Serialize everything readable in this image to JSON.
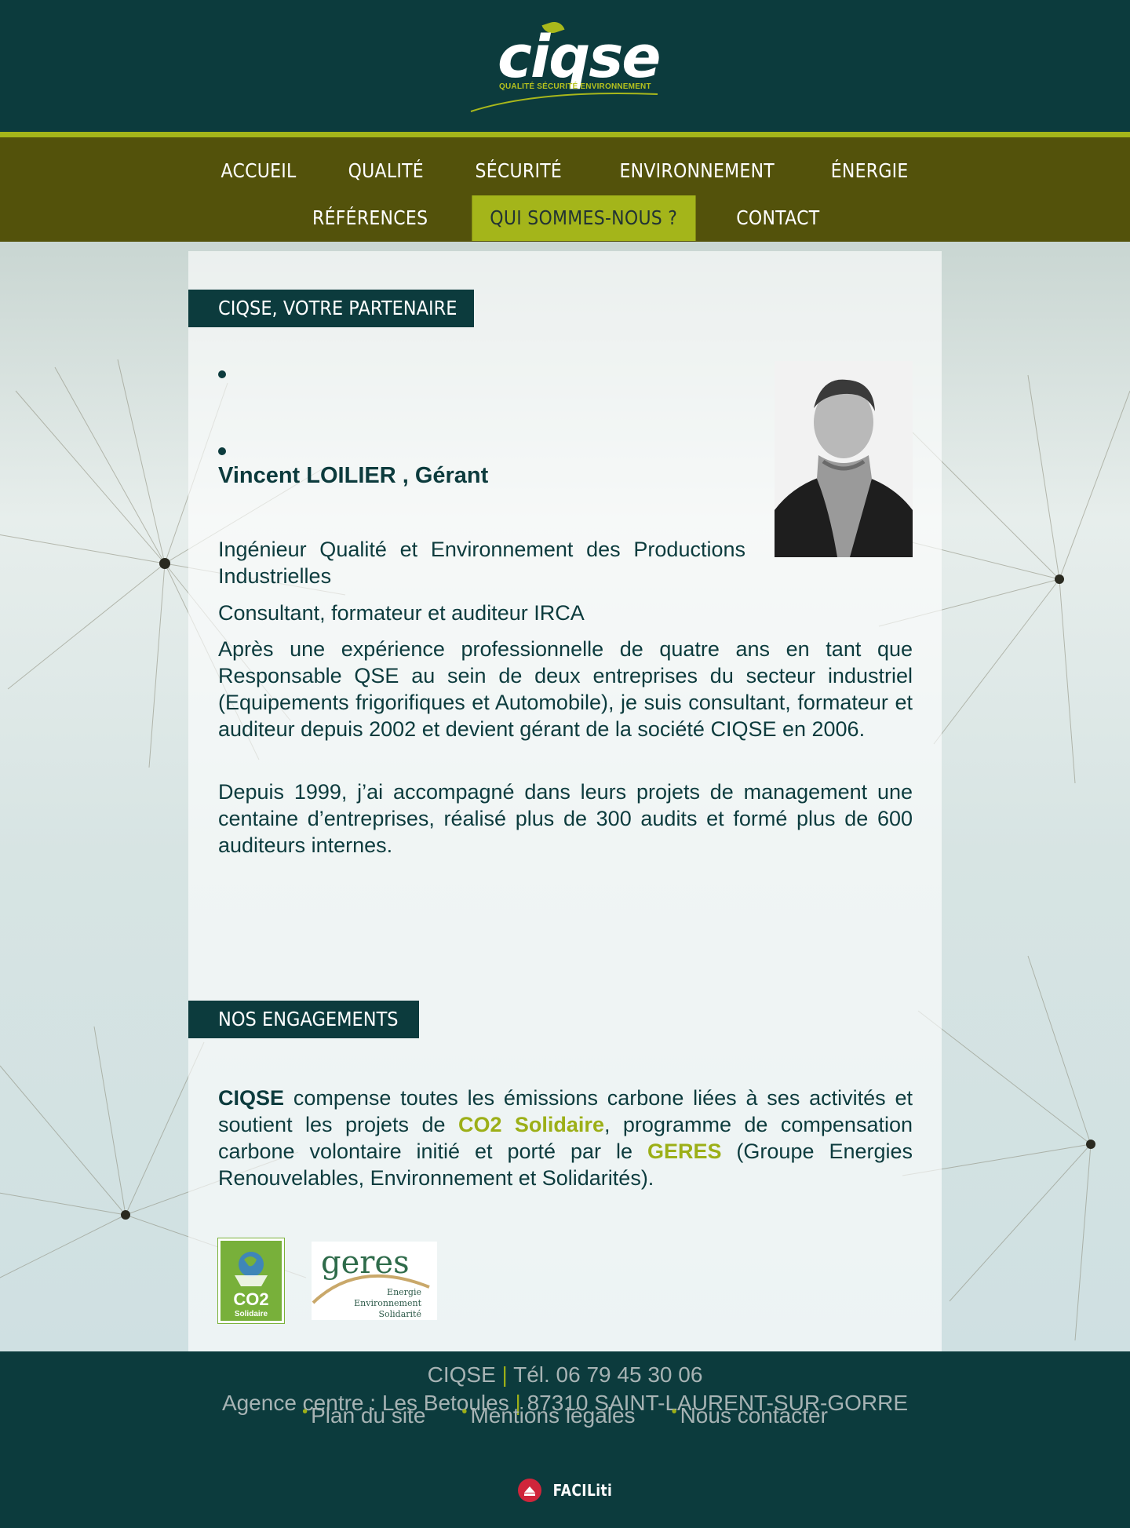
{
  "header": {
    "logo_word": "ciqse",
    "logo_tagline": "QUALITÉ SÉCURITÉ ENVIRONNEMENT"
  },
  "nav": {
    "row1": [
      "ACCUEIL",
      "QUALITÉ",
      "SÉCURITÉ",
      "ENVIRONNEMENT",
      "ÉNERGIE"
    ],
    "row2": [
      "RÉFÉRENCES",
      "QUI SOMMES-NOUS ?",
      "CONTACT"
    ],
    "active": "QUI SOMMES-NOUS ?"
  },
  "section1": {
    "title": "CIQSE, VOTRE PARTENAIRE",
    "name": "Vincent LOILIER , Gérant",
    "p1": "Ingénieur Qualité et Environnement des Productions Industrielles",
    "p2": "Consultant, formateur et auditeur IRCA",
    "p3": "Après une expérience professionnelle de quatre ans en tant que Responsable QSE au sein de deux entreprises du secteur industriel (Equipements frigorifiques et Automobile), je suis consultant, formateur et auditeur depuis 2002 et devient gérant de la société CIQSE en 2006.",
    "p4": "Depuis 1999, j’ai accompagné dans leurs projets de management une centaine d’entreprises, réalisé plus de 300 audits et formé plus de 600 auditeurs internes."
  },
  "section2": {
    "title": "NOS ENGAGEMENTS",
    "company": "CIQSE",
    "text_a": " compense toutes les émissions carbone liées à ses activités et soutient les projets de ",
    "co2_link": "CO2 Solidaire",
    "text_b": ", programme de compensation carbone volontaire initié et porté par le ",
    "geres_link": "GERES",
    "text_c": " (Groupe Energies Renouvelables, Environnement et Solidarités).",
    "co2_logo_text": "CO2",
    "co2_logo_sub": "Solidaire",
    "geres_logo_word": "geres",
    "geres_logo_lines": [
      "Energie",
      "Environnement",
      "Solidarité"
    ]
  },
  "footer": {
    "company": "CIQSE",
    "phone": "Tél. 06 79 45 30 06",
    "address_a": "Agence centre : Les Betoules",
    "address_b": "87310 SAINT-LAURENT-SUR-GORRE",
    "links": [
      "Plan du site",
      "Mentions légales",
      "Nous contacter"
    ],
    "faciliti": "FACILiti",
    "separator": "|"
  },
  "colors": {
    "dark_teal": "#0c3b3d",
    "olive": "#53520b",
    "lime": "#a4b51a"
  }
}
